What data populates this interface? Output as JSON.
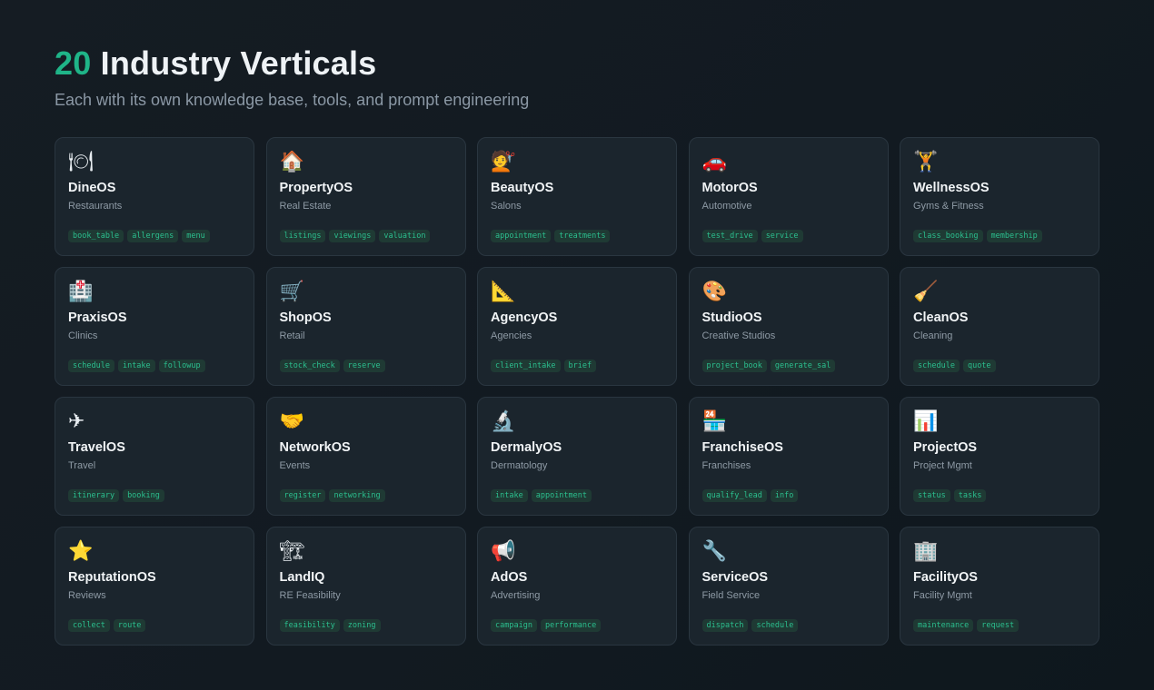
{
  "header": {
    "count": "20",
    "title": "Industry Verticals",
    "subtitle": "Each with its own knowledge base, tools, and prompt engineering"
  },
  "colors": {
    "accent": "#1fb488",
    "card_bg": "#1b252d",
    "tag_text": "#2bbf8e"
  },
  "cards": [
    {
      "icon": "🍽",
      "icon_name": "plate-cutlery-icon",
      "name": "DineOS",
      "sub": "Restaurants",
      "tags": [
        "book_table",
        "allergens",
        "menu"
      ]
    },
    {
      "icon": "🏠",
      "icon_name": "house-icon",
      "name": "PropertyOS",
      "sub": "Real Estate",
      "tags": [
        "listings",
        "viewings",
        "valuation"
      ]
    },
    {
      "icon": "💇",
      "icon_name": "haircut-icon",
      "name": "BeautyOS",
      "sub": "Salons",
      "tags": [
        "appointment",
        "treatments"
      ]
    },
    {
      "icon": "🚗",
      "icon_name": "car-icon",
      "name": "MotorOS",
      "sub": "Automotive",
      "tags": [
        "test_drive",
        "service"
      ]
    },
    {
      "icon": "🏋",
      "icon_name": "weightlifter-icon",
      "name": "WellnessOS",
      "sub": "Gyms & Fitness",
      "tags": [
        "class_booking",
        "membership"
      ]
    },
    {
      "icon": "🏥",
      "icon_name": "hospital-icon",
      "name": "PraxisOS",
      "sub": "Clinics",
      "tags": [
        "schedule",
        "intake",
        "followup"
      ]
    },
    {
      "icon": "🛒",
      "icon_name": "shopping-cart-icon",
      "name": "ShopOS",
      "sub": "Retail",
      "tags": [
        "stock_check",
        "reserve"
      ]
    },
    {
      "icon": "📐",
      "icon_name": "triangle-ruler-icon",
      "name": "AgencyOS",
      "sub": "Agencies",
      "tags": [
        "client_intake",
        "brief"
      ]
    },
    {
      "icon": "🎨",
      "icon_name": "palette-icon",
      "name": "StudioOS",
      "sub": "Creative Studios",
      "tags": [
        "project_book",
        "generate_sal"
      ]
    },
    {
      "icon": "🧹",
      "icon_name": "broom-icon",
      "name": "CleanOS",
      "sub": "Cleaning",
      "tags": [
        "schedule",
        "quote"
      ]
    },
    {
      "icon": "✈",
      "icon_name": "airplane-icon",
      "name": "TravelOS",
      "sub": "Travel",
      "tags": [
        "itinerary",
        "booking"
      ]
    },
    {
      "icon": "🤝",
      "icon_name": "handshake-icon",
      "name": "NetworkOS",
      "sub": "Events",
      "tags": [
        "register",
        "networking"
      ]
    },
    {
      "icon": "🔬",
      "icon_name": "microscope-icon",
      "name": "DermalyOS",
      "sub": "Dermatology",
      "tags": [
        "intake",
        "appointment"
      ]
    },
    {
      "icon": "🏪",
      "icon_name": "store-icon",
      "name": "FranchiseOS",
      "sub": "Franchises",
      "tags": [
        "qualify_lead",
        "info"
      ]
    },
    {
      "icon": "📊",
      "icon_name": "bar-chart-icon",
      "name": "ProjectOS",
      "sub": "Project Mgmt",
      "tags": [
        "status",
        "tasks"
      ]
    },
    {
      "icon": "⭐",
      "icon_name": "star-icon",
      "name": "ReputationOS",
      "sub": "Reviews",
      "tags": [
        "collect",
        "route"
      ]
    },
    {
      "icon": "🏗",
      "icon_name": "construction-icon",
      "name": "LandIQ",
      "sub": "RE Feasibility",
      "tags": [
        "feasibility",
        "zoning"
      ]
    },
    {
      "icon": "📢",
      "icon_name": "megaphone-icon",
      "name": "AdOS",
      "sub": "Advertising",
      "tags": [
        "campaign",
        "performance"
      ]
    },
    {
      "icon": "🔧",
      "icon_name": "wrench-icon",
      "name": "ServiceOS",
      "sub": "Field Service",
      "tags": [
        "dispatch",
        "schedule"
      ]
    },
    {
      "icon": "🏢",
      "icon_name": "office-building-icon",
      "name": "FacilityOS",
      "sub": "Facility Mgmt",
      "tags": [
        "maintenance",
        "request"
      ]
    }
  ]
}
